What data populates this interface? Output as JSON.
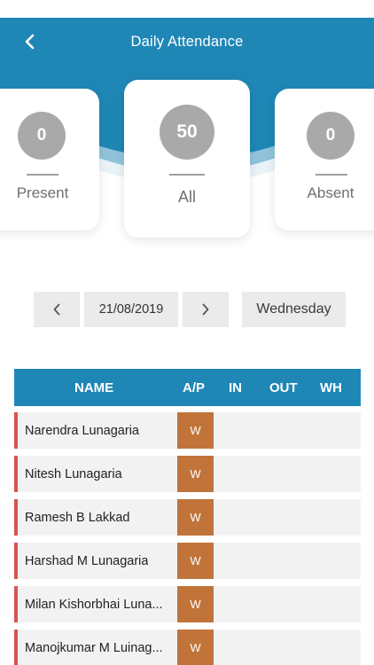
{
  "header": {
    "title": "Daily Attendance"
  },
  "summary": {
    "present": {
      "count": "0",
      "label": "Present"
    },
    "all": {
      "count": "50",
      "label": "All"
    },
    "absent": {
      "count": "0",
      "label": "Absent"
    }
  },
  "date_nav": {
    "date": "21/08/2019",
    "day": "Wednesday"
  },
  "table": {
    "columns": {
      "name": "NAME",
      "ap": "A/P",
      "in": "IN",
      "out": "OUT",
      "wh": "WH"
    },
    "rows": [
      {
        "name": "Narendra Lunagaria",
        "ap": "W",
        "in": "",
        "out": "",
        "wh": ""
      },
      {
        "name": "Nitesh Lunagaria",
        "ap": "W",
        "in": "",
        "out": "",
        "wh": ""
      },
      {
        "name": "Ramesh B Lakkad",
        "ap": "W",
        "in": "",
        "out": "",
        "wh": ""
      },
      {
        "name": "Harshad M Lunagaria",
        "ap": "W",
        "in": "",
        "out": "",
        "wh": ""
      },
      {
        "name": "Milan Kishorbhai Luna...",
        "ap": "W",
        "in": "",
        "out": "",
        "wh": ""
      },
      {
        "name": "Manojkumar M Luinag...",
        "ap": "W",
        "in": "",
        "out": "",
        "wh": ""
      }
    ]
  },
  "colors": {
    "header": "#1f87b6",
    "ap_weekoff": "#c0743a",
    "row_marker": "#d9534f"
  }
}
